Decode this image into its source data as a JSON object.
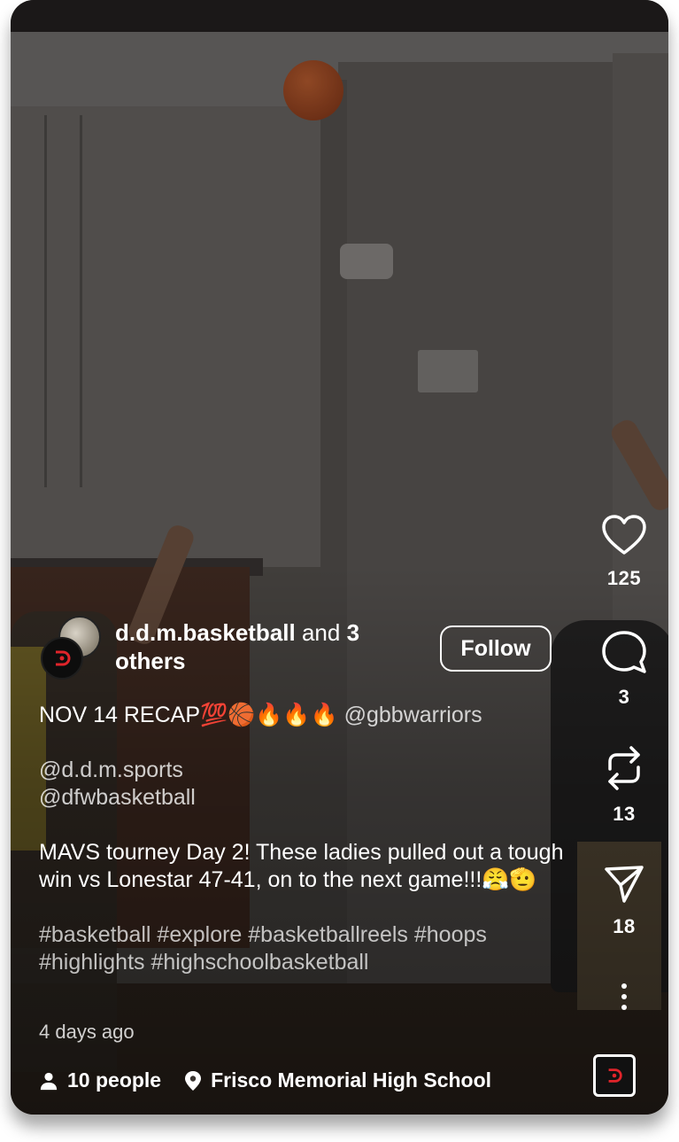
{
  "post": {
    "author": {
      "username": "d.d.m.basketball",
      "and_text": "and",
      "others_count": "3",
      "others_text": "others"
    },
    "follow_label": "Follow",
    "caption": {
      "line1_text": "NOV 14 RECAP💯🏀🔥🔥🔥",
      "line1_mention": "@gbbwarriors",
      "mention_2": "@d.d.m.sports",
      "mention_3": "@dfwbasketball",
      "body": "MAVS tourney Day 2! These ladies pulled out a tough win vs Lonestar 47-41, on to the next game!!!😤🫡",
      "hashtags": "#basketball #explore #basketballreels #hoops #highlights #highschoolbasketball"
    },
    "time_ago": "4 days ago",
    "tagged_people": "10 people",
    "location": "Frisco Memorial High School"
  },
  "actions": {
    "like_count": "125",
    "comment_count": "3",
    "repost_count": "13",
    "share_count": "18"
  },
  "icons": {
    "like": "heart-icon",
    "comment": "comment-bubble-icon",
    "repost": "repost-icon",
    "share": "send-icon",
    "more": "more-vertical-icon",
    "people": "person-icon",
    "location": "location-pin-icon"
  },
  "colors": {
    "text": "#ffffff",
    "brand_red": "#e0242a"
  }
}
